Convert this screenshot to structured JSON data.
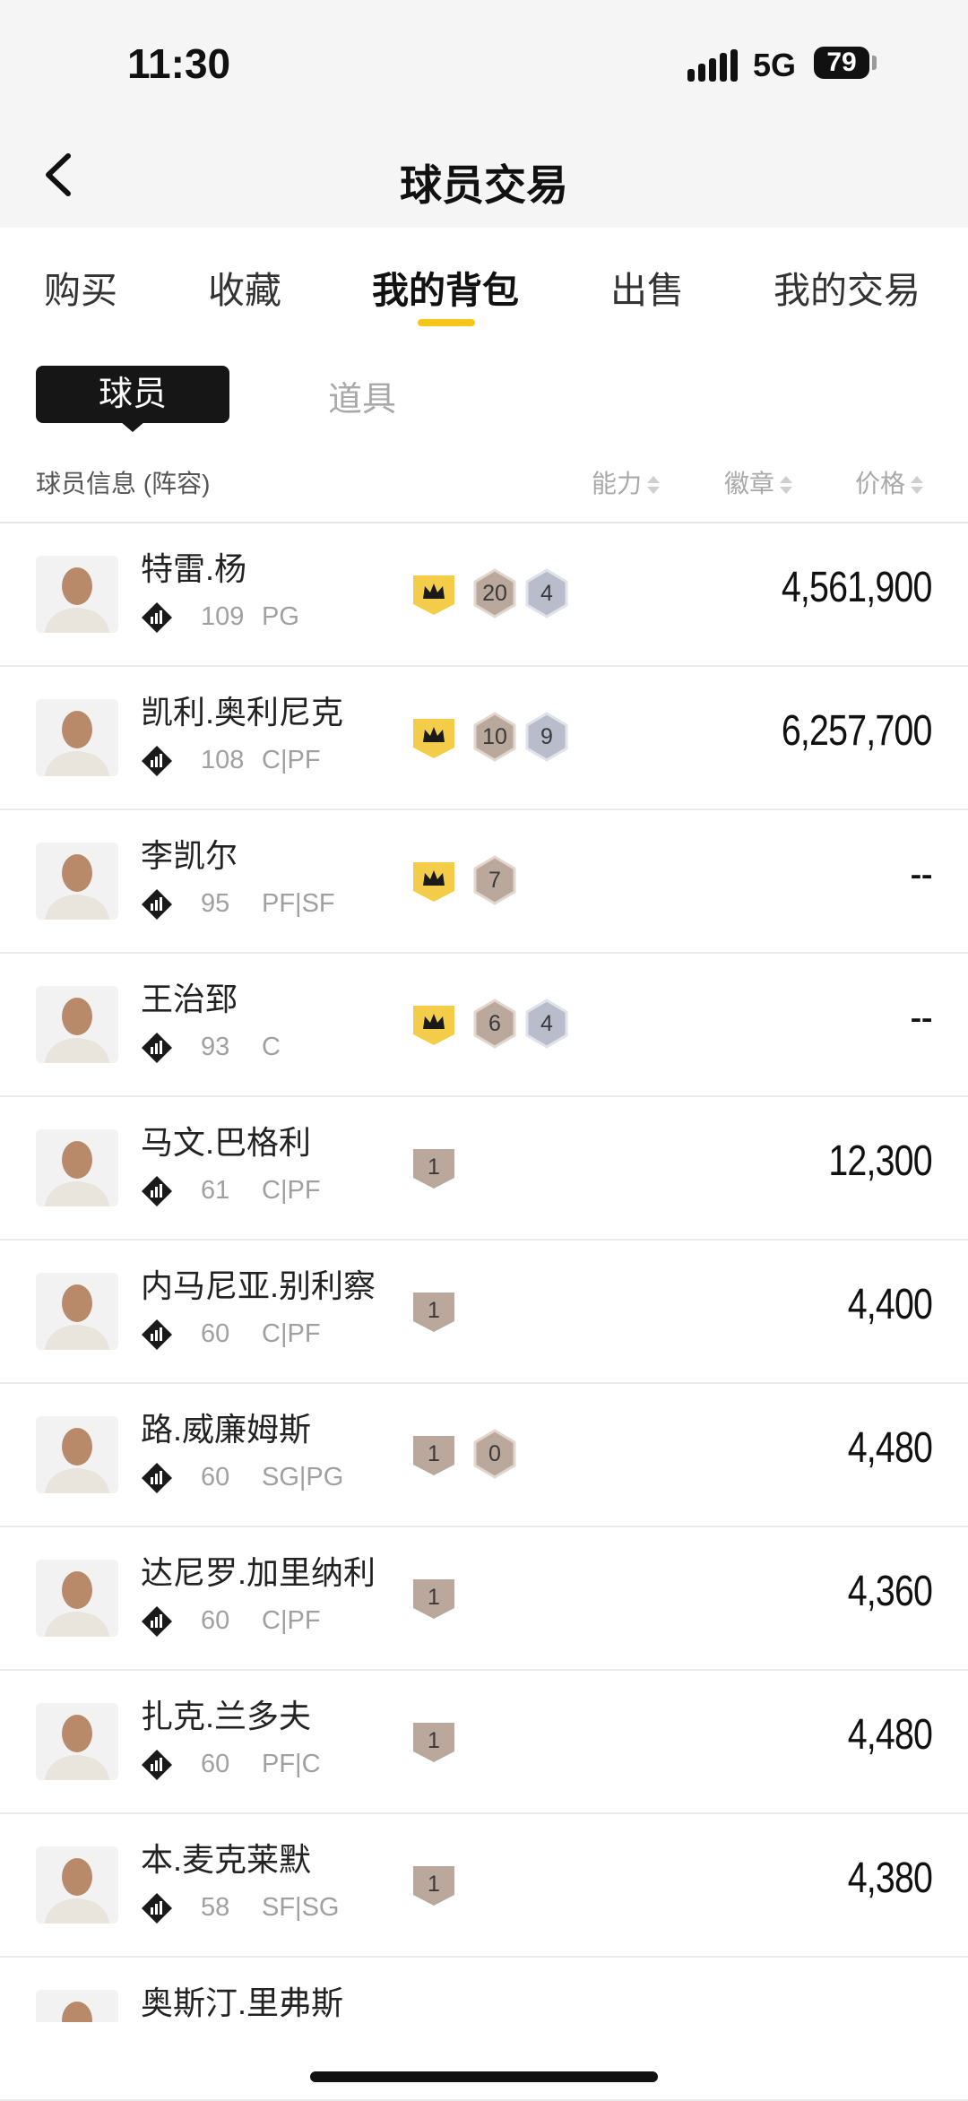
{
  "status_bar": {
    "time": "11:30",
    "network": "5G",
    "battery": "79"
  },
  "nav": {
    "title": "球员交易"
  },
  "tabs": [
    {
      "label": "购买",
      "active": false
    },
    {
      "label": "收藏",
      "active": false
    },
    {
      "label": "我的背包",
      "active": true
    },
    {
      "label": "出售",
      "active": false
    },
    {
      "label": "我的交易",
      "active": false
    }
  ],
  "segments": {
    "active": "球员",
    "inactive": "道具"
  },
  "list_header": {
    "info": "球员信息 (阵容)",
    "ability": "能力",
    "badge": "徽章",
    "price": "价格"
  },
  "colors": {
    "accent": "#f5c518",
    "crown_badge": "#f3cd4a",
    "bronze_badge": "#b9a89b",
    "silver_badge": "#b8bccb"
  },
  "players": [
    {
      "name": "特雷.杨",
      "rating": "109",
      "position": "PG",
      "tier": "diamond",
      "price": "4,561,900",
      "badges": [
        {
          "type": "crown",
          "label": ""
        },
        {
          "type": "bronze",
          "label": "20"
        },
        {
          "type": "silver",
          "label": "4"
        }
      ]
    },
    {
      "name": "凯利.奥利尼克",
      "rating": "108",
      "position": "C|PF",
      "tier": "diamond-14",
      "price": "6,257,700",
      "badges": [
        {
          "type": "crown",
          "label": ""
        },
        {
          "type": "bronze",
          "label": "10"
        },
        {
          "type": "silver",
          "label": "9"
        }
      ]
    },
    {
      "name": "李凯尔",
      "rating": "95",
      "position": "PF|SF",
      "tier": "star",
      "price": "--",
      "badges": [
        {
          "type": "crown",
          "label": ""
        },
        {
          "type": "bronze",
          "label": "7"
        }
      ]
    },
    {
      "name": "王治郅",
      "rating": "93",
      "position": "C",
      "tier": "star",
      "price": "--",
      "badges": [
        {
          "type": "crown",
          "label": ""
        },
        {
          "type": "bronze",
          "label": "6"
        },
        {
          "type": "silver",
          "label": "4"
        }
      ]
    },
    {
      "name": "马文.巴格利",
      "rating": "61",
      "position": "C|PF",
      "tier": "diamond",
      "price": "12,300",
      "badges": [
        {
          "type": "shield",
          "label": "1"
        }
      ]
    },
    {
      "name": "内马尼亚.别利察",
      "rating": "60",
      "position": "C|PF",
      "tier": "diamond",
      "price": "4,400",
      "badges": [
        {
          "type": "shield",
          "label": "1"
        }
      ]
    },
    {
      "name": "路.威廉姆斯",
      "rating": "60",
      "position": "SG|PG",
      "tier": "diamond",
      "price": "4,480",
      "badges": [
        {
          "type": "shield",
          "label": "1"
        },
        {
          "type": "bronze",
          "label": "0"
        }
      ]
    },
    {
      "name": "达尼罗.加里纳利",
      "rating": "60",
      "position": "C|PF",
      "tier": "diamond",
      "price": "4,360",
      "badges": [
        {
          "type": "shield",
          "label": "1"
        }
      ]
    },
    {
      "name": "扎克.兰多夫",
      "rating": "60",
      "position": "PF|C",
      "tier": "diamond",
      "price": "4,480",
      "badges": [
        {
          "type": "shield",
          "label": "1"
        }
      ]
    },
    {
      "name": "本.麦克莱默",
      "rating": "58",
      "position": "SF|SG",
      "tier": "diamond",
      "price": "4,380",
      "badges": [
        {
          "type": "shield",
          "label": "1"
        }
      ]
    },
    {
      "name": "奥斯汀.里弗斯",
      "rating": "",
      "position": "",
      "tier": "",
      "price": "",
      "badges": []
    }
  ]
}
